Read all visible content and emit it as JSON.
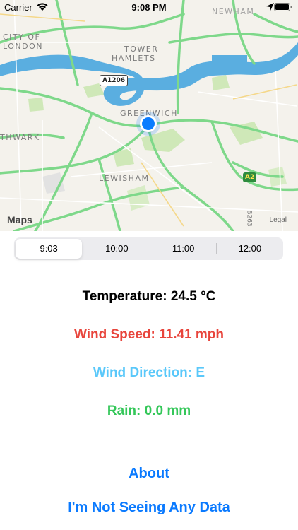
{
  "status_bar": {
    "carrier": "Carrier",
    "time": "9:08 PM"
  },
  "map": {
    "labels": {
      "city_of_london_1": "CITY OF",
      "city_of_london_2": "LONDON",
      "tower_hamlets_1": "TOWER",
      "tower_hamlets_2": "HAMLETS",
      "greenwich": "GREENWICH",
      "southwark": "THWARK",
      "lewisham": "LEWISHAM",
      "newham": "NEWHAM"
    },
    "roads": {
      "a1206": "A1206",
      "a2": "A2",
      "b263": "B263"
    },
    "attribution": "Maps",
    "legal": "Legal",
    "colors": {
      "land": "#f4f2ec",
      "water": "#5aaee0",
      "roads_major": "#7ed88a",
      "parks": "#cfe8b8",
      "location": "#0a7cff"
    }
  },
  "time_segments": {
    "items": [
      "9:03",
      "10:00",
      "11:00",
      "12:00"
    ],
    "selected_index": 0
  },
  "weather": {
    "temperature": "Temperature: 24.5 °C",
    "wind_speed": "Wind Speed: 11.41 mph",
    "wind_direction": "Wind Direction: E",
    "rain": "Rain: 0.0 mm",
    "colors": {
      "temperature": "#000000",
      "wind_speed": "#e8453c",
      "wind_direction": "#5ac8fa",
      "rain": "#34c759"
    }
  },
  "links": {
    "about": "About",
    "no_data": "I'm Not Seeing Any Data"
  }
}
